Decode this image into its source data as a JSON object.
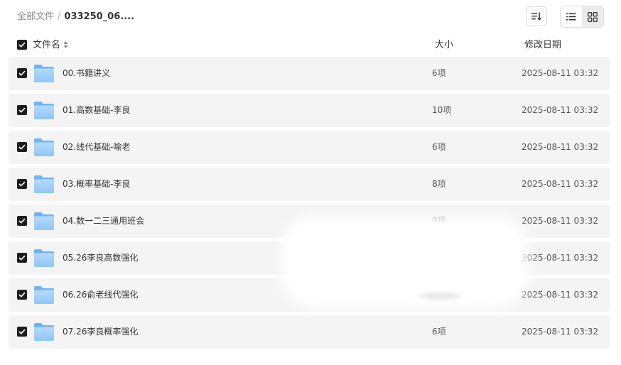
{
  "breadcrumb": {
    "root": "全部文件",
    "separator": "/",
    "current": "033250_06...."
  },
  "toolbar": {
    "sort_icon": "sort-list-icon",
    "list_view_icon": "list-view-icon",
    "grid_view_icon": "grid-view-icon",
    "active_view": "grid"
  },
  "table": {
    "headers": {
      "name": "文件名",
      "size": "大小",
      "modified": "修改日期"
    },
    "rows": [
      {
        "name": "00.书籍讲义",
        "size": "6项",
        "modified": "2025-08-11 03:32",
        "checked": true
      },
      {
        "name": "01.高数基础-李良",
        "size": "10项",
        "modified": "2025-08-11 03:32",
        "checked": true
      },
      {
        "name": "02.线代基础-喻老",
        "size": "6项",
        "modified": "2025-08-11 03:32",
        "checked": true
      },
      {
        "name": "03.概率基础-李良",
        "size": "8项",
        "modified": "2025-08-11 03:32",
        "checked": true
      },
      {
        "name": "04.数一二三通用班会",
        "size": "3项",
        "modified": "2025-08-11 03:32",
        "checked": true
      },
      {
        "name": "05.26李良高数强化",
        "size": "",
        "modified": "2025-08-11 03:32",
        "checked": true
      },
      {
        "name": "06.26俞老线代强化",
        "size": "",
        "modified": "2025-08-11 03:32",
        "checked": true
      },
      {
        "name": "07.26李良概率强化",
        "size": "6项",
        "modified": "2025-08-11 03:32",
        "checked": true
      }
    ]
  },
  "colors": {
    "row_background": "#f4f4f4",
    "checkbox": "#1d1d1d",
    "folder_light": "#a9d4ff",
    "folder_dark": "#6fb3f7"
  }
}
